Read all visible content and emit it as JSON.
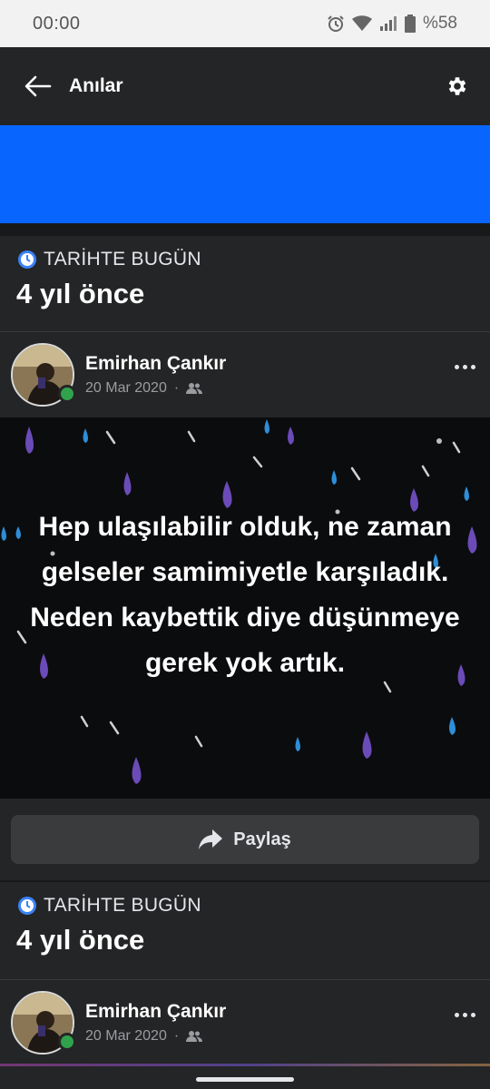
{
  "status_bar": {
    "time": "00:00",
    "battery": "%58"
  },
  "app_bar": {
    "title": "Anılar"
  },
  "memories": [
    {
      "tag": "TARİHTE BUGÜN",
      "years_ago": "4 yıl önce",
      "author": "Emirhan Çankır",
      "date": "20 Mar 2020",
      "separator": "·",
      "post_text": "Hep ulaşılabilir olduk, ne zaman gelseler samimiyetle karşıladık. Neden kaybettik diye düşünmeye gerek yok artık.",
      "share_label": "Paylaş"
    },
    {
      "tag": "TARİHTE BUGÜN",
      "years_ago": "4 yıl önce",
      "author": "Emirhan Çankır",
      "date": "20 Mar 2020",
      "separator": "·"
    }
  ],
  "colors": {
    "accent": "#0866ff",
    "online": "#31a24c",
    "surface": "#242526",
    "background": "#18191a"
  }
}
